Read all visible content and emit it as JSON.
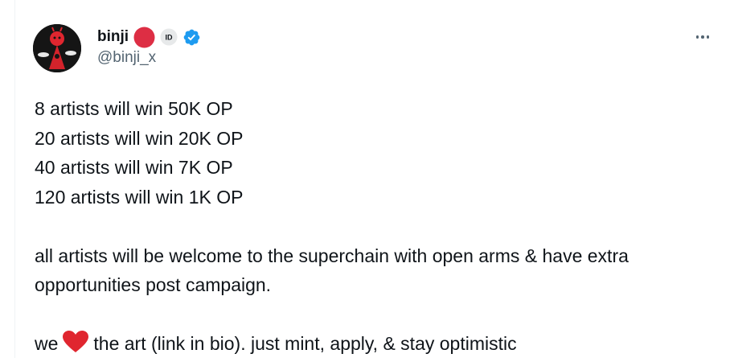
{
  "author": {
    "display_name": "binji",
    "handle": "@binji_x",
    "badges": [
      "red-circle-emoji",
      "id-badge-icon",
      "verified-badge-icon"
    ],
    "verified_color": "#1d9bf0"
  },
  "menu": {
    "icon": "more-horizontal-icon"
  },
  "post": {
    "lines": [
      "8 artists will win 50K OP",
      "20 artists will win 20K OP",
      "40 artists will win 7K OP",
      "120 artists will win 1K OP"
    ],
    "paragraph_2_line_1": "all artists will be welcome to the superchain with open arms & have extra",
    "paragraph_2_line_2": "opportunities post campaign.",
    "paragraph_3_prefix": "we",
    "paragraph_3_emoji": "red-heart-emoji",
    "paragraph_3_suffix": "the art (link in bio). just mint, apply, & stay optimistic"
  },
  "colors": {
    "text_primary": "#0f1419",
    "text_secondary": "#536471",
    "brand_red": "#e0262f",
    "heart_red": "#e0262f"
  }
}
